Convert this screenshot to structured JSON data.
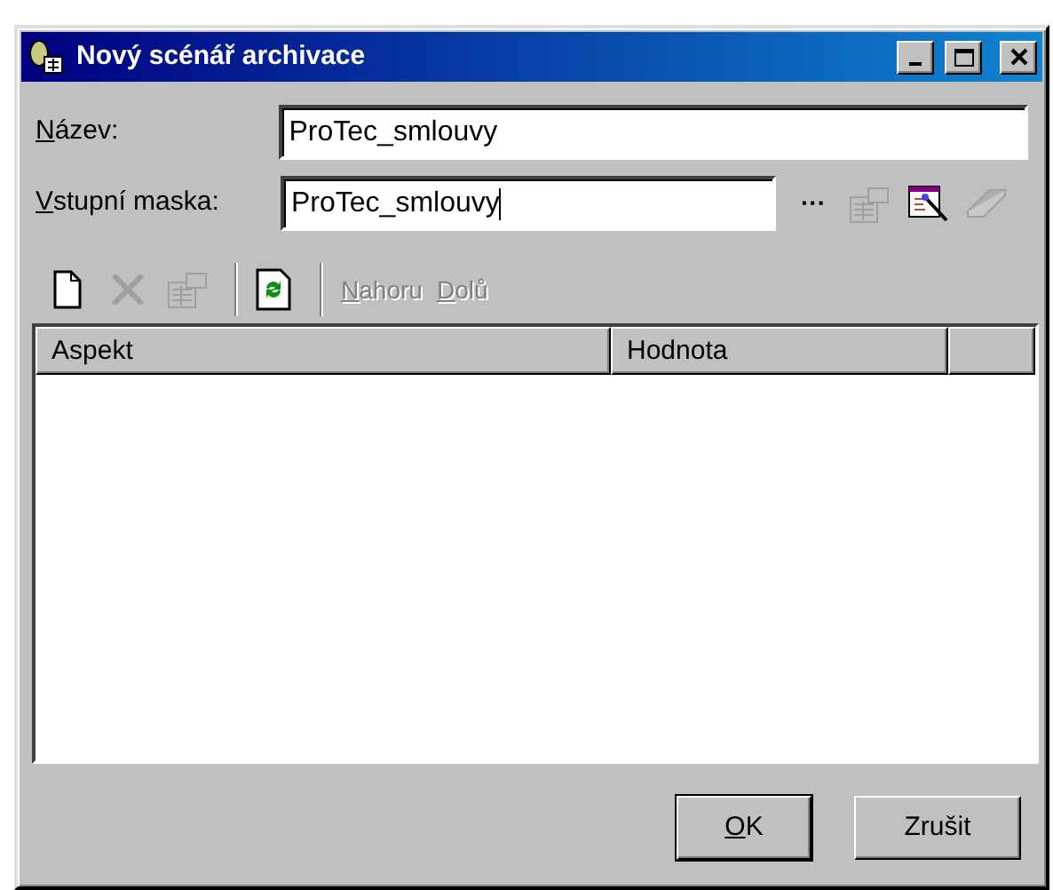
{
  "window": {
    "title": "Nový scénář archivace"
  },
  "fields": [
    {
      "label": "Název:",
      "accel": true,
      "value": "ProTec_smlouvy",
      "focused": false
    },
    {
      "label": "Vstupní maska:",
      "accel": true,
      "value": "ProTec_smlouvy",
      "focused": true
    }
  ],
  "mask_tools": [
    {
      "kind": "text",
      "text": "···",
      "disabled": false
    },
    {
      "kind": "properties",
      "disabled": true
    },
    {
      "kind": "wizard",
      "disabled": false
    },
    {
      "kind": "eraser",
      "disabled": true
    }
  ],
  "toolbar": [
    {
      "kind": "new",
      "disabled": false
    },
    {
      "kind": "delete",
      "disabled": true
    },
    {
      "kind": "properties",
      "disabled": true
    },
    {
      "kind": "separator"
    },
    {
      "kind": "refresh",
      "disabled": false
    },
    {
      "kind": "separator"
    },
    {
      "kind": "text",
      "text": "Nahoru",
      "accel": true,
      "disabled": true
    },
    {
      "kind": "text",
      "text": "Dolů",
      "accel": true,
      "disabled": true
    }
  ],
  "table": {
    "columns": [
      "Aspekt",
      "Hodnota"
    ]
  },
  "buttons": [
    {
      "label": "OK",
      "accel": true,
      "default": true
    },
    {
      "label": "Zrušit",
      "accel": false,
      "default": false
    }
  ]
}
